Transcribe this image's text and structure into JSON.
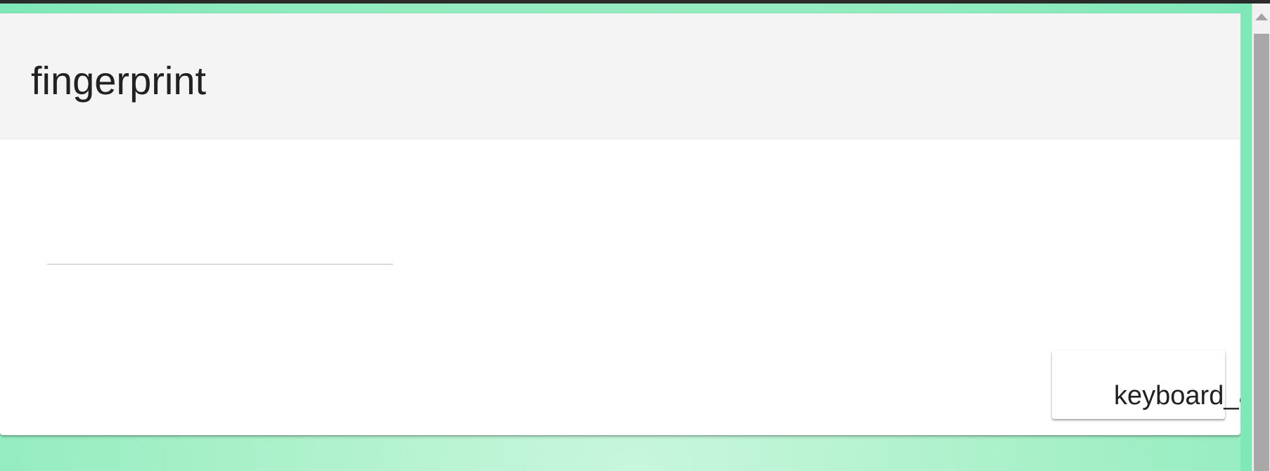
{
  "header": {
    "icon_text": "fingerprint"
  },
  "form": {
    "input_value": "",
    "input_placeholder": ""
  },
  "actions": {
    "next_button_label": "keyboard_a"
  },
  "colors": {
    "background_accent": "#7fe8b8",
    "card": "#ffffff",
    "header": "#f4f4f4",
    "text": "#212121"
  }
}
